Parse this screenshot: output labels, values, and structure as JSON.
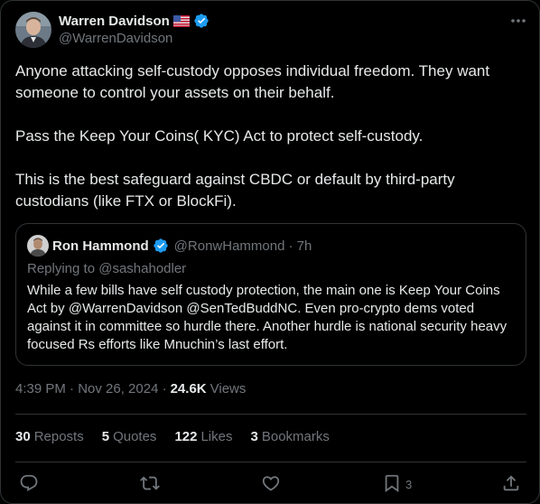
{
  "author": {
    "name": "Warren Davidson",
    "handle": "@WarrenDavidson"
  },
  "tweet": {
    "paragraphs": [
      "Anyone attacking self-custody opposes individual freedom. They want someone to control your assets on their behalf.",
      "Pass the Keep Your Coins( KYC) Act to protect self-custody.",
      "This is the best safeguard against CBDC or default by third-party custodians (like FTX or BlockFi)."
    ]
  },
  "quote": {
    "name": "Ron Hammond",
    "handle": "@RonwHammond",
    "time": "· 7h",
    "replying_label": "Replying to",
    "replying_to": "@sashahodler",
    "text": "While a few bills have self custody protection, the main one is Keep Your Coins Act by @WarrenDavidson @SenTedBuddNC. Even pro-crypto dems voted against it in committee so hurdle there. Another hurdle is national security heavy focused Rs efforts like Mnuchin’s last effort."
  },
  "meta": {
    "time": "4:39 PM · Nov 26, 2024 ·",
    "views_count": "24.6K",
    "views_label": "Views"
  },
  "stats": {
    "reposts_count": "30",
    "reposts_label": "Reposts",
    "quotes_count": "5",
    "quotes_label": "Quotes",
    "likes_count": "122",
    "likes_label": "Likes",
    "bookmarks_count": "3",
    "bookmarks_label": "Bookmarks"
  },
  "actions": {
    "bookmark_count": "3"
  },
  "icons": {
    "more": "more-icon",
    "reply": "reply-icon",
    "repost": "repost-icon",
    "like": "like-icon",
    "bookmark": "bookmark-icon",
    "share": "share-icon",
    "verified": "verified-icon",
    "flag": "us-flag-icon"
  },
  "colors": {
    "background": "#000000",
    "text": "#e7e9ea",
    "muted": "#71767b",
    "border": "#2f3336",
    "verified": "#1d9bf0"
  }
}
